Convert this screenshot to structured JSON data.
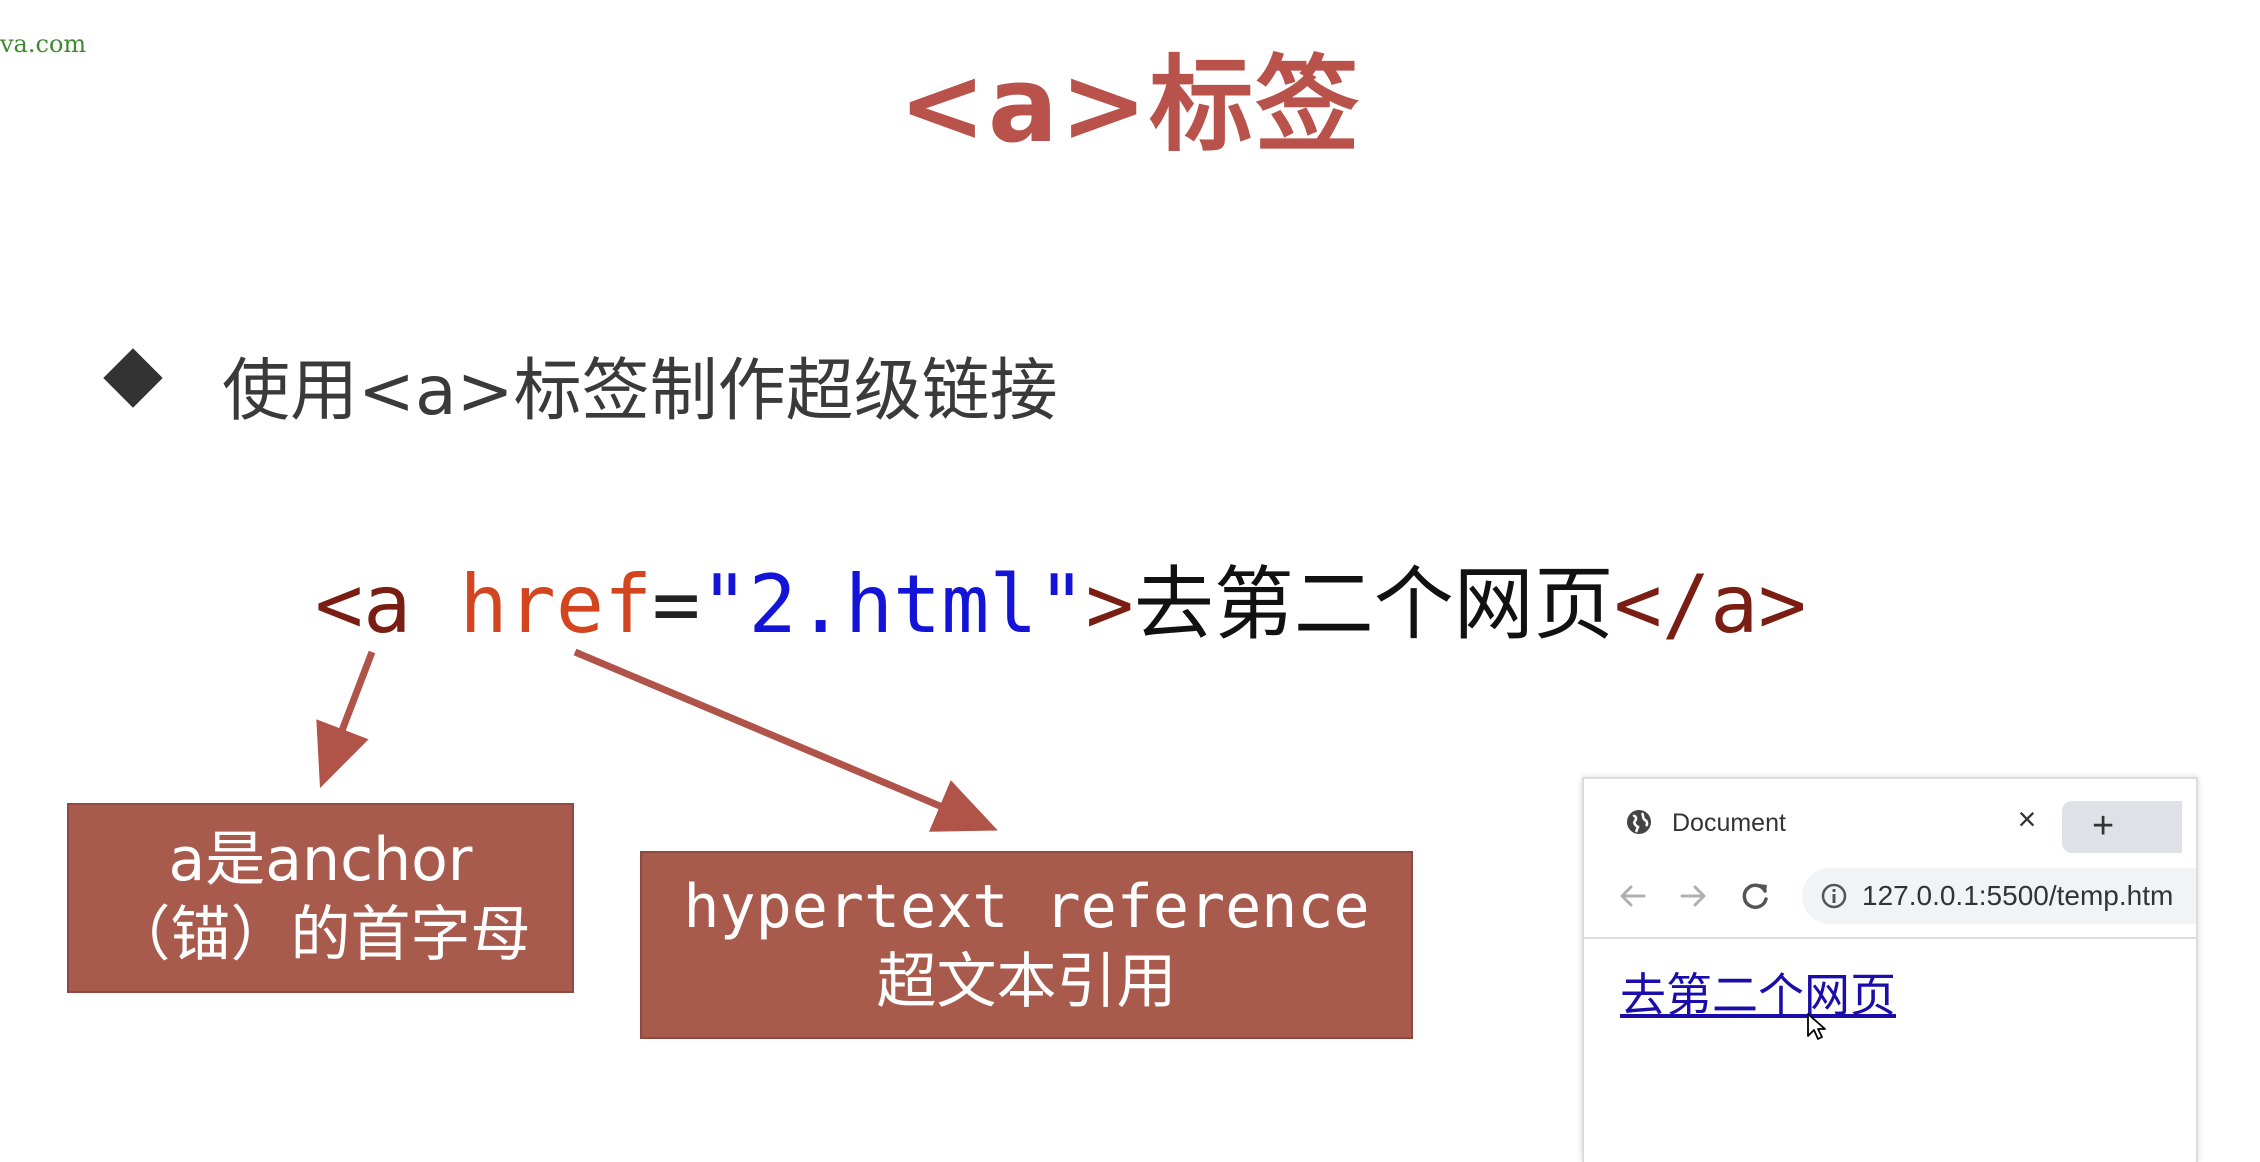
{
  "watermark": "va.com",
  "title": "<a>标签",
  "bullet": "使用<a>标签制作超级链接",
  "code": {
    "tag_open": "<a",
    "attr": "href",
    "eq": "=",
    "value": "\"2.html\"",
    "tag_close": ">",
    "text": "去第二个网页",
    "tag_end": "</a>"
  },
  "callouts": {
    "a_line1": "a是anchor",
    "a_line2": "（锚）的首字母",
    "href_line1": "hypertext reference",
    "href_line2": "超文本引用"
  },
  "browser": {
    "tab_title": "Document",
    "close_glyph": "×",
    "new_tab_glyph": "+",
    "url": "127.0.0.1:5500/temp.htm",
    "link_text": "去第二个网页"
  },
  "colors": {
    "title": "#b8524a",
    "callout_bg": "#a85a4d",
    "tag": "#7a1e14",
    "attr": "#d2451f",
    "string": "#1414d8",
    "link": "#1a0dab"
  },
  "icons": [
    "globe-icon",
    "back-icon",
    "forward-icon",
    "reload-icon",
    "info-icon",
    "cursor-icon"
  ]
}
